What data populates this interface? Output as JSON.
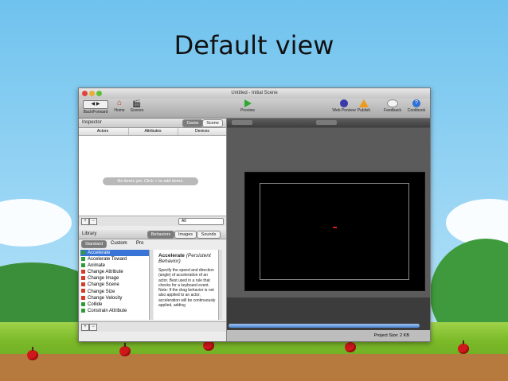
{
  "slide": {
    "title": "Default view"
  },
  "window": {
    "title": "Untitled - Initial Scene"
  },
  "toolbar": {
    "back_forward": "Back/Forward",
    "home": "Home",
    "scenes": "Scenes",
    "preview": "Preview",
    "web_preview": "Web Preview",
    "publish": "Publish",
    "feedback": "Feedback",
    "cookbook": "Cookbook"
  },
  "inspector": {
    "title": "Inspector",
    "seg_game": "Game",
    "seg_scene": "Scene",
    "tabs": [
      "Actors",
      "Attributes",
      "Devices"
    ],
    "empty_message": "No items yet. Click + to add items.",
    "add_label": "+",
    "remove_label": "−",
    "filter_value": "All"
  },
  "library": {
    "title": "Library",
    "seg_behaviors": "Behaviors",
    "seg_images": "Images",
    "seg_sounds": "Sounds",
    "tabs": [
      "Standard",
      "Custom",
      "Pro"
    ],
    "items": [
      "Accelerate",
      "Accelerate Toward",
      "Animate",
      "Change Attribute",
      "Change Image",
      "Change Scene",
      "Change Size",
      "Change Velocity",
      "Collide",
      "Constrain Attribute"
    ],
    "icon_colors": [
      "#2f9a3a",
      "#2f9a3a",
      "#2f9a3a",
      "#d63a2a",
      "#d63a2a",
      "#d63a2a",
      "#d63a2a",
      "#d63a2a",
      "#2f9a3a",
      "#2f9a3a"
    ],
    "selected": "Accelerate",
    "desc_title": "Accelerate",
    "desc_subtitle": "(Persistent Behavior)",
    "desc_body": "Specify the speed and direction (angle) of acceleration of an actor. Best used in a rule that checks for a keyboard event. Note: If the drag behavior is not also applied to an actor, acceleration will be continuously applied, adding",
    "add_label": "+",
    "remove_label": "−"
  },
  "status": {
    "project_size": "Project Size: 2 KB"
  },
  "colors": {
    "accent": "#3875d7",
    "titlebar_red": "#e0443e",
    "titlebar_yellow": "#e6b030",
    "titlebar_green": "#5fbf3a"
  }
}
